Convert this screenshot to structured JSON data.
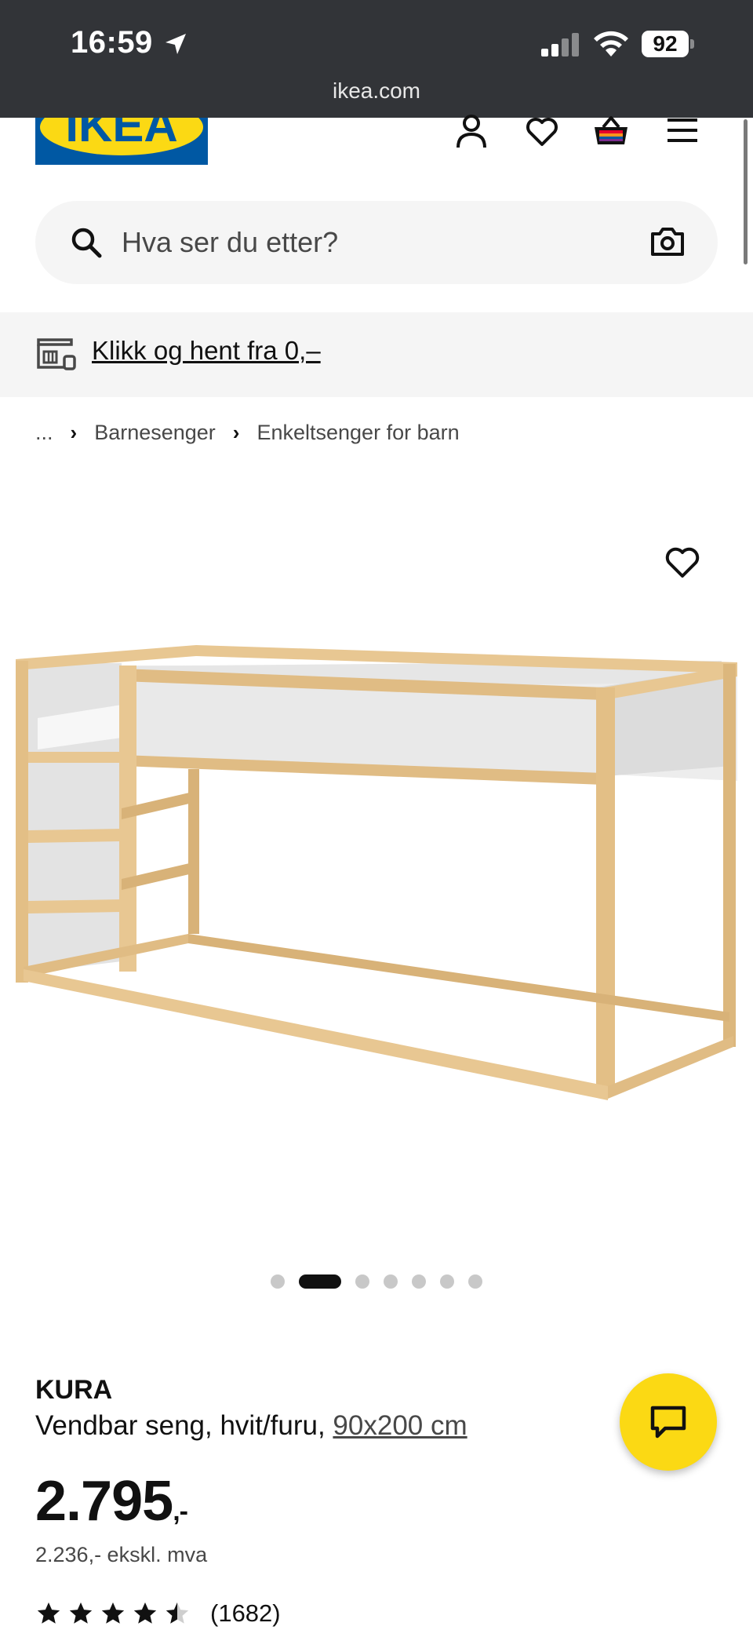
{
  "status_bar": {
    "time": "16:59",
    "battery": "92",
    "url": "ikea.com"
  },
  "header": {
    "logo_text": "IKEA",
    "brand_colors": {
      "blue": "#0058a3",
      "yellow": "#fbd914"
    },
    "icons": [
      "user-icon",
      "heart-icon",
      "basket-icon",
      "menu-icon"
    ]
  },
  "search": {
    "placeholder": "Hva ser du etter?",
    "value": ""
  },
  "promo": {
    "link_text": "Klikk og hent fra 0,–"
  },
  "breadcrumb": {
    "ellipsis": "...",
    "items": [
      "Barnesenger",
      "Enkeltsenger for barn"
    ]
  },
  "carousel": {
    "total": 7,
    "active_index": 1
  },
  "product": {
    "name": "KURA",
    "description": "Vendbar seng, hvit/furu,",
    "size_link": "90x200 cm",
    "price": "2.795",
    "price_suffix": ",-",
    "price_ex_vat": "2.236,- ekskl. mva",
    "rating_value": 4.5,
    "rating_count": "(1682)"
  }
}
